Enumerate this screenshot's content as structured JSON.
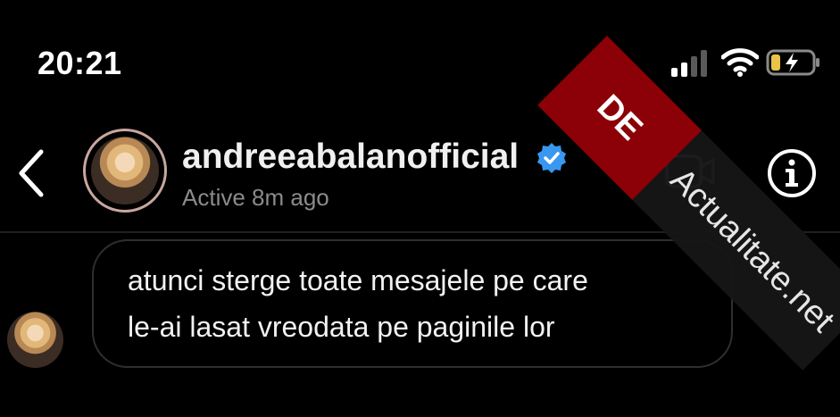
{
  "status_bar": {
    "time": "20:21",
    "icons": [
      "cellular-signal-icon",
      "wifi-icon",
      "battery-charging-icon"
    ]
  },
  "header": {
    "back_icon": "chevron-left-icon",
    "username": "andreeabalanofficial",
    "verified_icon": "verified-badge-icon",
    "status": "Active 8m ago",
    "video_icon": "video-call-icon",
    "info_icon": "info-icon"
  },
  "messages": [
    {
      "lines": [
        "atunci sterge toate mesajele pe care",
        "le-ai lasat vreodata pe paginile lor"
      ]
    }
  ],
  "watermark": {
    "tag": "DE",
    "text": "Actualitate.net"
  },
  "colors": {
    "background": "#000000",
    "verified_blue": "#3897f0",
    "watermark_red": "#8c0007"
  }
}
